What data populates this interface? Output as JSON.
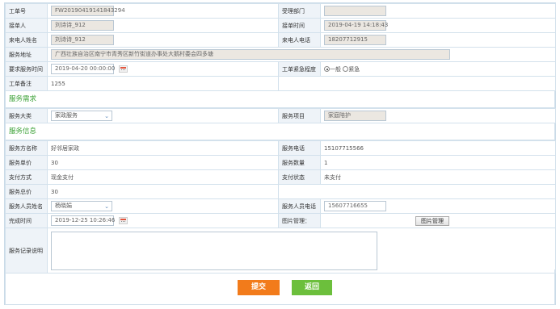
{
  "rows": {
    "order_no": {
      "label": "工单号",
      "value": "FW20190419141843294"
    },
    "dept": {
      "label": "受理部门",
      "value": ""
    },
    "receiver": {
      "label": "接单人",
      "value": "刘诗诗_912"
    },
    "receive_time": {
      "label": "接单时间",
      "value": "2019-04-19 14:18:43"
    },
    "caller_name": {
      "label": "来电人姓名",
      "value": "刘诗诗_912"
    },
    "caller_phone": {
      "label": "来电人电话",
      "value": "18207712915"
    },
    "address": {
      "label": "服务地址",
      "value": "广西壮族自治区南宁市青秀区新竹街道办事处大鹅村委会四多塘"
    },
    "req_time": {
      "label": "要求服务时间",
      "value": "2019-04-20 00:00:00"
    },
    "urgency": {
      "label": "工单紧急程度",
      "options": [
        "一般",
        "紧急"
      ],
      "selected": "一般"
    },
    "remark": {
      "label": "工单备注",
      "value": "1255"
    }
  },
  "sections": {
    "demand": "服务需求",
    "info": "服务信息"
  },
  "demand": {
    "category": {
      "label": "服务大类",
      "value": "家政服务"
    },
    "item": {
      "label": "服务项目",
      "value": "家庭陪护"
    }
  },
  "info": {
    "provider": {
      "label": "服务方名称",
      "value": "好邻居家政"
    },
    "provider_phone": {
      "label": "服务电话",
      "value": "15107715566"
    },
    "unit_price": {
      "label": "服务单价",
      "value": "30"
    },
    "quantity": {
      "label": "服务数量",
      "value": "1"
    },
    "pay_method": {
      "label": "支付方式",
      "value": "现金支付"
    },
    "pay_status": {
      "label": "支付状态",
      "value": "未支付"
    },
    "total": {
      "label": "服务总价",
      "value": "30"
    },
    "staff_name": {
      "label": "服务人员姓名",
      "value": "杨晓娟"
    },
    "staff_phone": {
      "label": "服务人员电话",
      "value": "15607716655"
    },
    "finish_time": {
      "label": "完成时间",
      "value": "2019-12-25 10:26:46"
    },
    "image_mgmt": {
      "label": "图片管理：",
      "button": "图片管理"
    },
    "record": {
      "label": "服务记录说明",
      "value": ""
    }
  },
  "actions": {
    "submit": "提交",
    "back": "返回"
  },
  "colors": {
    "section_green": "#3fa33a",
    "submit_orange": "#f27b1b",
    "back_green": "#6cbf3c",
    "label_bg": "#eef3f8"
  }
}
